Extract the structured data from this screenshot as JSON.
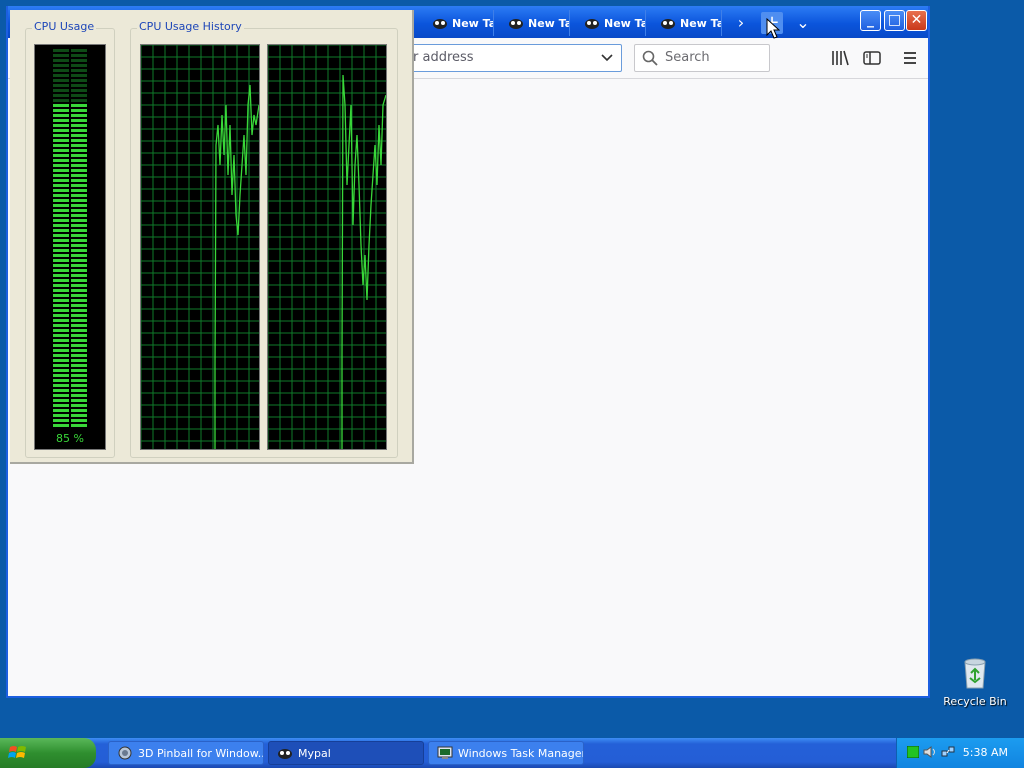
{
  "browser": {
    "tabs": [
      {
        "label": "New Tab"
      },
      {
        "label": "New Tab"
      },
      {
        "label": "New Tab"
      },
      {
        "label": "New Tab"
      }
    ],
    "url_placeholder": "Search or enter address",
    "url_visible_text": "r address",
    "search_placeholder": "Search",
    "tab_scroll_glyph": "›",
    "new_tab_glyph": "+",
    "tab_list_glyph": "⌄",
    "minimize_glyph": "_",
    "maximize_glyph": "□",
    "close_glyph": "✕"
  },
  "task_manager": {
    "cpu_usage_title": "CPU Usage",
    "cpu_history_title": "CPU Usage History",
    "cpu_percent_label": "85 %",
    "cpu_percent": 85,
    "graph_color": "#39d739",
    "grid_color": "#0f7a2a"
  },
  "desktop": {
    "recycle_bin_label": "Recycle Bin"
  },
  "taskbar": {
    "items": [
      {
        "label": "3D Pinball for Window...",
        "icon": "pinball-icon"
      },
      {
        "label": "Mypal",
        "icon": "mypal-icon"
      },
      {
        "label": "Windows Task Manager",
        "icon": "task-manager-icon"
      }
    ],
    "clock": "5:38 AM"
  }
}
